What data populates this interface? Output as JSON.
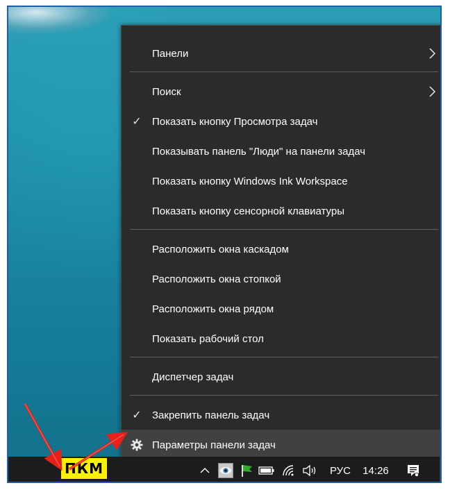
{
  "menu": {
    "items": [
      {
        "label": "Панели",
        "checked": false,
        "submenu": true
      },
      {
        "label": "Поиск",
        "checked": false,
        "submenu": true
      },
      {
        "label": "Показать кнопку Просмотра задач",
        "checked": true,
        "submenu": false
      },
      {
        "label": "Показывать панель \"Люди\" на панели задач",
        "checked": false,
        "submenu": false
      },
      {
        "label": "Показать кнопку Windows Ink Workspace",
        "checked": false,
        "submenu": false
      },
      {
        "label": "Показать кнопку сенсорной клавиатуры",
        "checked": false,
        "submenu": false
      },
      {
        "label": "Расположить окна каскадом",
        "checked": false,
        "submenu": false
      },
      {
        "label": "Расположить окна стопкой",
        "checked": false,
        "submenu": false
      },
      {
        "label": "Расположить окна рядом",
        "checked": false,
        "submenu": false
      },
      {
        "label": "Показать рабочий стол",
        "checked": false,
        "submenu": false
      },
      {
        "label": "Диспетчер задач",
        "checked": false,
        "submenu": false
      },
      {
        "label": "Закрепить панель задач",
        "checked": true,
        "submenu": false
      },
      {
        "label": "Параметры панели задач",
        "checked": false,
        "submenu": false,
        "icon": "gear-icon",
        "highlighted": true
      }
    ],
    "check_glyph": "✓"
  },
  "taskbar": {
    "language": "РУС",
    "time": "14:26",
    "icons": [
      "chevron-up-icon",
      "eye-app-icon",
      "green-flag-icon",
      "battery-icon",
      "wifi-icon",
      "speaker-icon",
      "notification-icon"
    ]
  },
  "annotation": {
    "label": "ПКМ",
    "color": "#fff200",
    "arrow_color": "#e8201a"
  }
}
